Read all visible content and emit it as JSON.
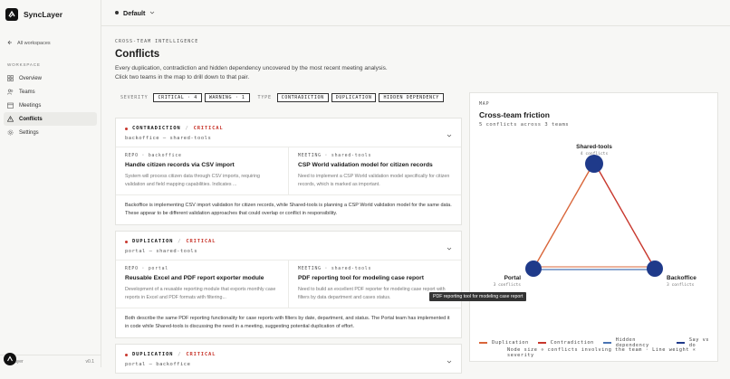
{
  "brand": {
    "name": "SyncLayer"
  },
  "sidebar": {
    "back_label": "All workspaces",
    "section_label": "WORKSPACE",
    "items": [
      {
        "label": "Overview",
        "icon": "grid-icon"
      },
      {
        "label": "Teams",
        "icon": "users-icon"
      },
      {
        "label": "Meetings",
        "icon": "calendar-icon"
      },
      {
        "label": "Conflicts",
        "icon": "alert-triangle-icon",
        "active": true
      },
      {
        "label": "Settings",
        "icon": "gear-icon"
      }
    ],
    "footer_name": "ayer",
    "footer_version": "v0.1"
  },
  "topbar": {
    "workspace": "Default"
  },
  "header": {
    "eyebrow": "CROSS-TEAM INTELLIGENCE",
    "title": "Conflicts",
    "desc_line1": "Every duplication, contradiction and hidden dependency uncovered by the most recent meeting analysis.",
    "desc_line2": "Click two teams in the map to drill down to that pair."
  },
  "filters": {
    "severity_label": "SEVERITY",
    "critical": "CRITICAL · 4",
    "warning": "WARNING · 1",
    "type_label": "TYPE",
    "types": [
      "CONTRADICTION",
      "DUPLICATION",
      "HIDDEN DEPENDENCY"
    ]
  },
  "cards": [
    {
      "type": "CONTRADICTION",
      "severity": "CRITICAL",
      "pair": "backoffice — shared-tools",
      "left": {
        "meta": "REPO · backoffice",
        "title": "Handle citizen records via CSV import",
        "body": "System will process citizen data through CSV imports, requiring validation and field mapping capabilities. Indicates ..."
      },
      "right": {
        "meta": "MEETING · shared-tools",
        "title": "CSP World validation model for citizen records",
        "body": "Need to implement a CSP World validation model specifically for citizen records, which is marked as important."
      },
      "note": "Backoffice is implementing CSV import validation for citizen records, while Shared-tools is planning a CSP World validation model for the same data. These appear to be different validation approaches that could overlap or conflict in responsibility."
    },
    {
      "type": "DUPLICATION",
      "severity": "CRITICAL",
      "pair": "portal — shared-tools",
      "left": {
        "meta": "REPO · portal",
        "title": "Reusable Excel and PDF report exporter module",
        "body": "Development of a reusable reporting module that exports monthly case reports in Excel and PDF formats with filtering..."
      },
      "right": {
        "meta": "MEETING · shared-tools",
        "title": "PDF reporting tool for modeling case report",
        "body": "Need to build an excellent PDF reporter for modeling case report with filters by data department and cases status."
      },
      "note": "Both describe the same PDF reporting functionality for case reports with filters by date, department, and status. The Portal team has implemented it in code while Shared-tools is discussing the need in a meeting, suggesting potential duplication of effort."
    },
    {
      "type": "DUPLICATION",
      "severity": "CRITICAL",
      "pair": "portal — backoffice"
    }
  ],
  "map": {
    "eyebrow": "MAP",
    "title": "Cross-team friction",
    "subtitle": "5 conflicts across 3 teams",
    "nodes": [
      {
        "name": "Shared-tools",
        "count": "4 conflicts"
      },
      {
        "name": "Portal",
        "count": "3 conflicts"
      },
      {
        "name": "Backoffice",
        "count": "3 conflicts"
      }
    ],
    "legend": [
      "Duplication",
      "Contradiction",
      "Hidden dependency",
      "Say vs do"
    ],
    "legend_colors": [
      "#d9663a",
      "#c8372d",
      "#4a74b3",
      "#1f3a8a"
    ],
    "legend_note": "Node size ∝ conflicts involving the team · Line weight ∝ severity",
    "tooltip": "PDF reporting tool for modeling case report"
  }
}
